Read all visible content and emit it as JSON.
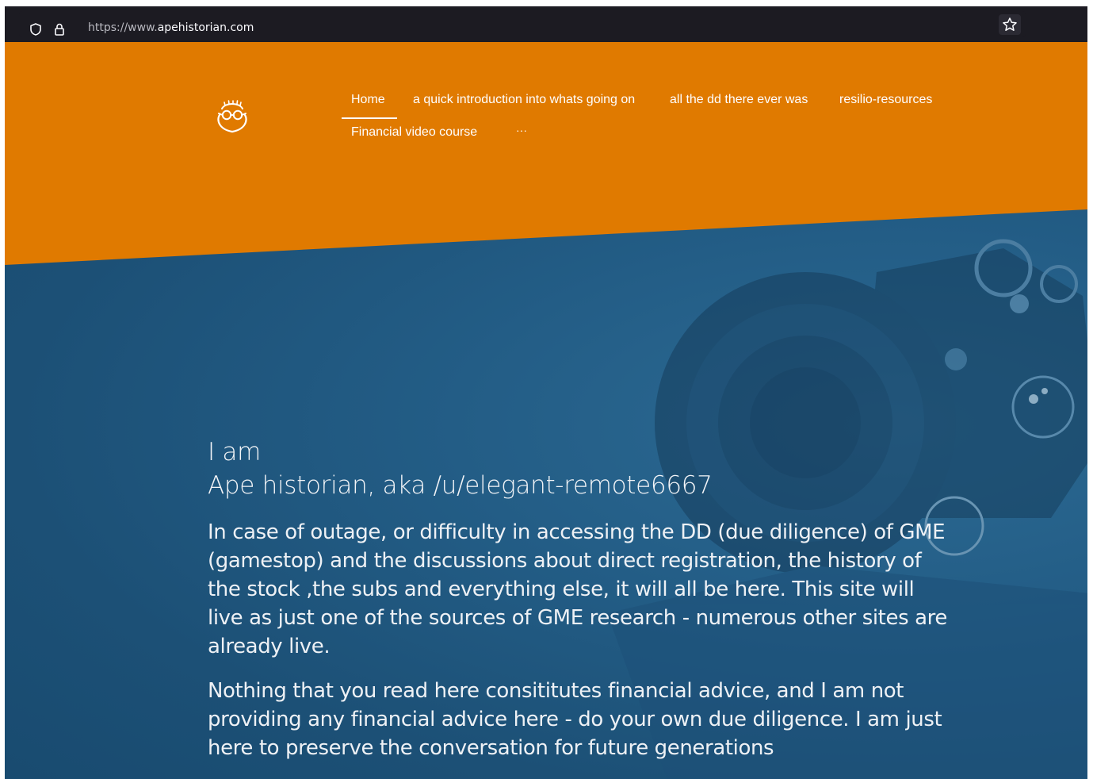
{
  "browser": {
    "url_prefix": "https://www.",
    "url_domain": "apehistorian.com",
    "icons": [
      "shield-icon",
      "lock-icon",
      "star-icon"
    ]
  },
  "site": {
    "logo_icon": "glasses-face-icon",
    "nav": {
      "items": [
        {
          "label": "Home",
          "active": true
        },
        {
          "label": "a quick introduction into whats going on"
        },
        {
          "label": "all the dd there ever was"
        },
        {
          "label": "resilio-resources"
        },
        {
          "label": "Financial video course"
        },
        {
          "label": "···"
        }
      ]
    }
  },
  "hero": {
    "line1": "I am",
    "line2": "Ape historian, aka /u/elegant-remote6667",
    "paragraph1": "In case of outage, or difficulty in accessing the DD (due diligence) of GME (gamestop) and the discussions about direct registration, the history of the stock ,the subs and everything else, it will all be here. This site will live as just one of the sources of GME research - numerous other sites are already live.",
    "paragraph2": "Nothing that you read here consititutes financial advice, and I am not providing any financial advice here - do your own due diligence. I am just here to preserve the conversation for future generations"
  },
  "colors": {
    "header_orange": "#e07a00",
    "hero_blue": "#1e5278",
    "browser_bar": "#1c1b22"
  }
}
